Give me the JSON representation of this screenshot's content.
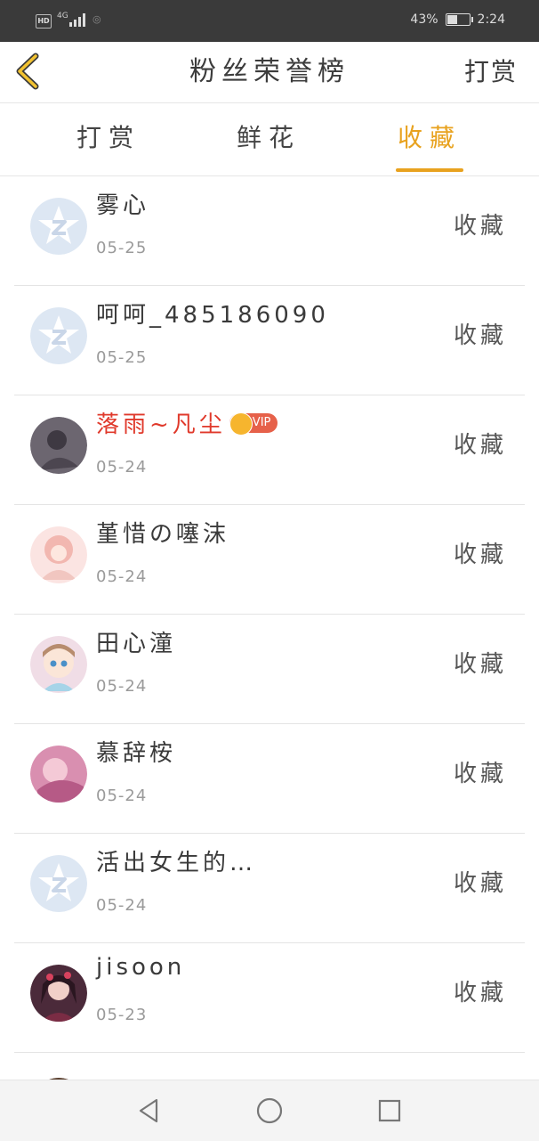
{
  "status_bar": {
    "network": "HD",
    "signal": "4G",
    "battery_percent": "43%",
    "battery_level": 0.43,
    "time": "2:24"
  },
  "header": {
    "title": "粉丝荣誉榜",
    "action_label": "打赏",
    "back_icon": "chevron-left-icon"
  },
  "tabs": [
    {
      "label": "打赏",
      "active": false
    },
    {
      "label": "鲜花",
      "active": false
    },
    {
      "label": "收藏",
      "active": true
    }
  ],
  "colors": {
    "accent": "#e8a21f",
    "vip_name": "#e0392b",
    "vip_badge": "#e6614a"
  },
  "fans": [
    {
      "name": "雾心",
      "date": "05-25",
      "type": "收藏",
      "avatar": "default-avatar-icon",
      "vip": false
    },
    {
      "name": "呵呵_485186090",
      "date": "05-25",
      "type": "收藏",
      "avatar": "default-avatar-icon",
      "vip": false
    },
    {
      "name": "落雨~凡尘",
      "date": "05-24",
      "type": "收藏",
      "avatar": "user-photo",
      "vip": true,
      "vip_label": "VIP"
    },
    {
      "name": "堇惜の噻沫",
      "date": "05-24",
      "type": "收藏",
      "avatar": "user-photo",
      "vip": false
    },
    {
      "name": "田心潼",
      "date": "05-24",
      "type": "收藏",
      "avatar": "user-photo",
      "vip": false
    },
    {
      "name": "慕辞桉",
      "date": "05-24",
      "type": "收藏",
      "avatar": "user-photo",
      "vip": false
    },
    {
      "name": "活出女生的…",
      "date": "05-24",
      "type": "收藏",
      "avatar": "default-avatar-icon",
      "vip": false
    },
    {
      "name": "jisoon",
      "date": "05-23",
      "type": "收藏",
      "avatar": "user-photo",
      "vip": false
    }
  ],
  "nav": {
    "back_icon": "triangle-back-icon",
    "home_icon": "circle-home-icon",
    "recents_icon": "square-recents-icon"
  }
}
